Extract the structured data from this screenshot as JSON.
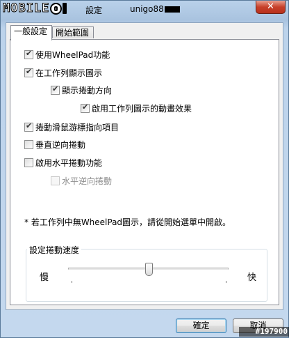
{
  "window": {
    "logo_text": "MOBILE",
    "title": "設定",
    "username": "unigo88",
    "close_label": "✕"
  },
  "tabs": [
    {
      "label": "一般設定",
      "active": true
    },
    {
      "label": "開始範圍",
      "active": false
    }
  ],
  "options": [
    {
      "label": "使用WheelPad功能",
      "checked": true,
      "enabled": true
    },
    {
      "label": "在工作列顯示圖示",
      "checked": true,
      "enabled": true
    },
    {
      "label": "顯示捲動方向",
      "checked": true,
      "enabled": true
    },
    {
      "label": "啟用工作列圖示的動畫效果",
      "checked": true,
      "enabled": true
    },
    {
      "label": "捲動滑鼠游標指向項目",
      "checked": true,
      "enabled": true
    },
    {
      "label": "垂直逆向捲動",
      "checked": false,
      "enabled": true
    },
    {
      "label": "啟用水平捲動功能",
      "checked": false,
      "enabled": true
    },
    {
      "label": "水平逆向捲動",
      "checked": false,
      "enabled": false
    }
  ],
  "note": "* 若工作列中無WheelPad圖示，請從開始選單中開啟。",
  "speed": {
    "group_title": "設定捲動速度",
    "slow_label": "慢",
    "fast_label": "快",
    "value": 0.5
  },
  "buttons": {
    "ok": "確定",
    "cancel": "取消"
  },
  "watermark": "#197900"
}
